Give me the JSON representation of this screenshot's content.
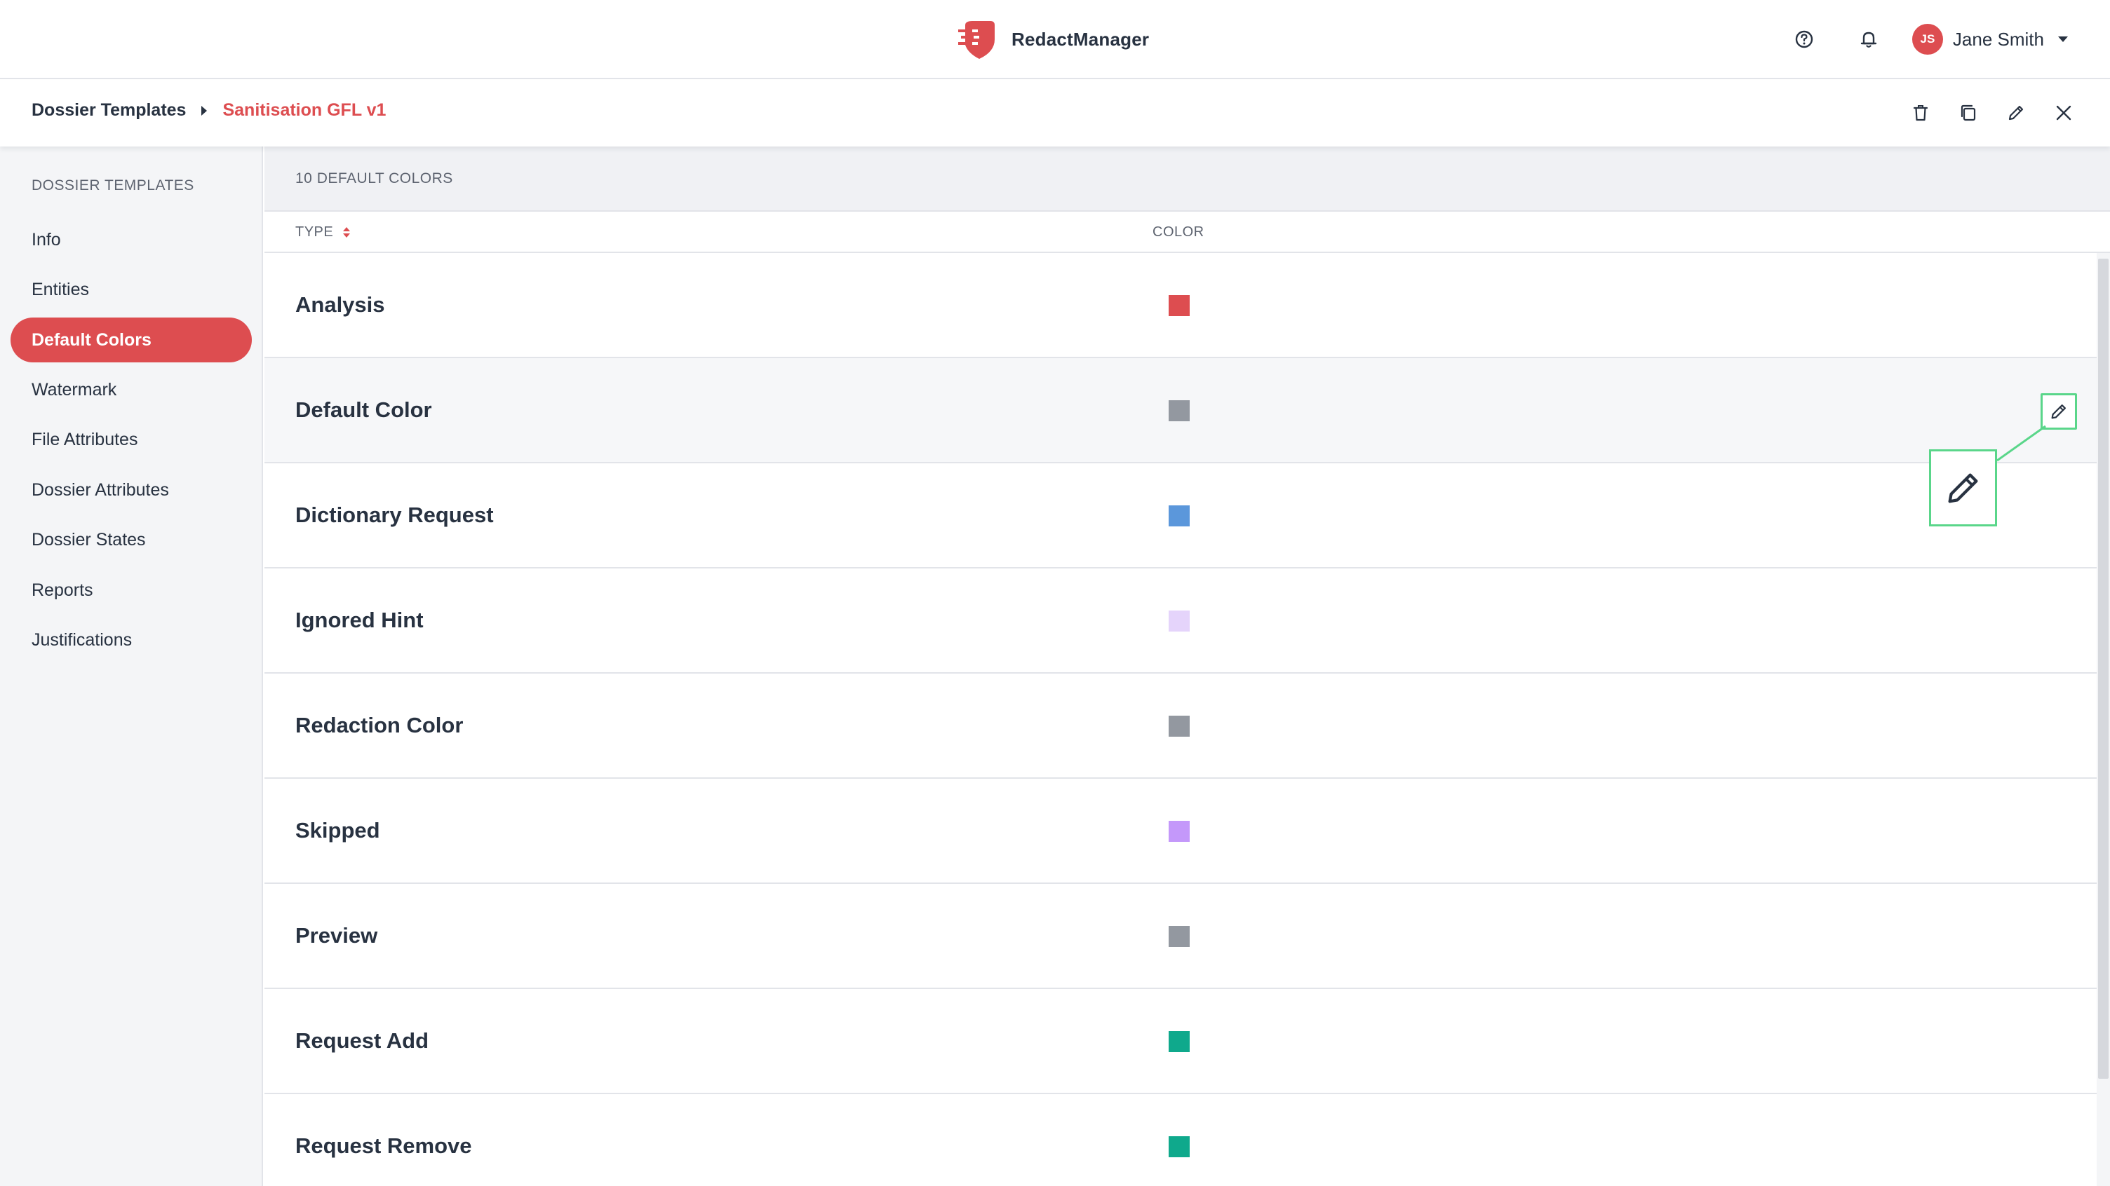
{
  "app": {
    "name": "RedactManager",
    "brand_color": "#dd4d50"
  },
  "header": {
    "help_icon": "help-circle-icon",
    "notifications_icon": "bell-icon",
    "user": {
      "initials": "JS",
      "name": "Jane Smith"
    }
  },
  "breadcrumb": {
    "root": "Dossier Templates",
    "current": "Sanitisation GFL v1",
    "actions": [
      "trash-icon",
      "copy-icon",
      "edit-icon",
      "close-icon"
    ]
  },
  "sidebar": {
    "title": "DOSSIER TEMPLATES",
    "items": [
      {
        "label": "Info",
        "active": false
      },
      {
        "label": "Entities",
        "active": false
      },
      {
        "label": "Default Colors",
        "active": true
      },
      {
        "label": "Watermark",
        "active": false
      },
      {
        "label": "File Attributes",
        "active": false
      },
      {
        "label": "Dossier Attributes",
        "active": false
      },
      {
        "label": "Dossier States",
        "active": false
      },
      {
        "label": "Reports",
        "active": false
      },
      {
        "label": "Justifications",
        "active": false
      }
    ]
  },
  "list": {
    "count_label": "10 DEFAULT COLORS",
    "columns": {
      "type": "TYPE",
      "color": "COLOR"
    },
    "rows": [
      {
        "label": "Analysis",
        "color": "#dd4d50"
      },
      {
        "label": "Default Color",
        "color": "#9398a0",
        "hovered": true
      },
      {
        "label": "Dictionary Request",
        "color": "#5b97db"
      },
      {
        "label": "Ignored Hint",
        "color": "#e5d4fb"
      },
      {
        "label": "Redaction Color",
        "color": "#9398a0"
      },
      {
        "label": "Skipped",
        "color": "#c498fa"
      },
      {
        "label": "Preview",
        "color": "#9398a0"
      },
      {
        "label": "Request Add",
        "color": "#0fa98c"
      },
      {
        "label": "Request Remove",
        "color": "#0fa98c"
      }
    ]
  }
}
